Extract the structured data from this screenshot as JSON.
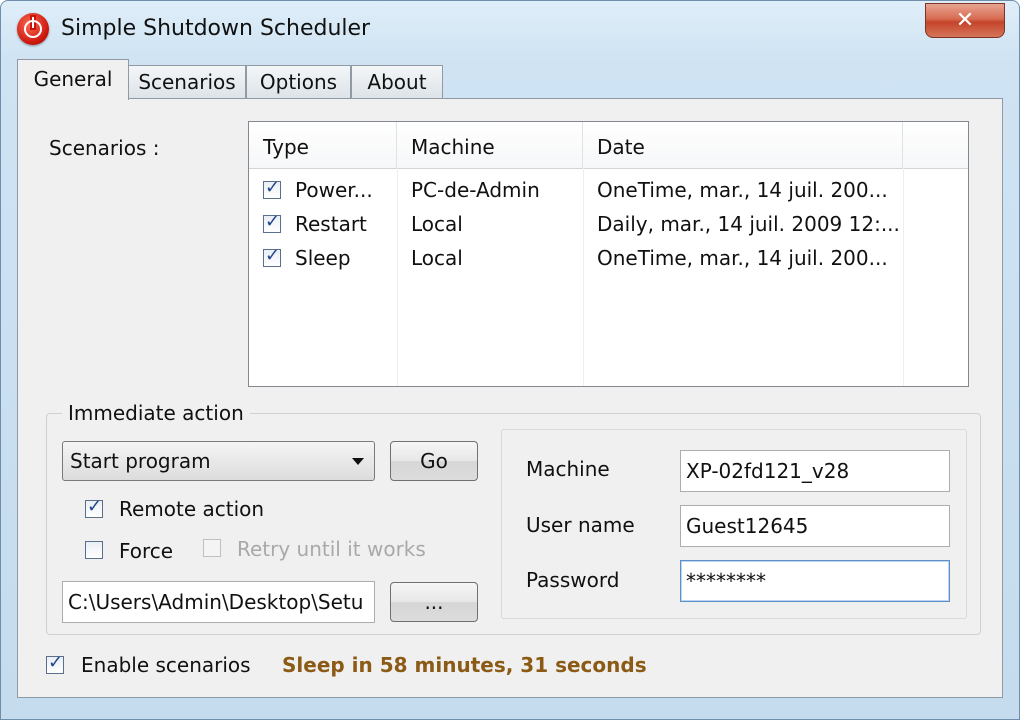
{
  "window": {
    "title": "Simple Shutdown Scheduler",
    "close_label": "✕"
  },
  "tabs": [
    {
      "label": "General",
      "active": true
    },
    {
      "label": "Scenarios",
      "active": false
    },
    {
      "label": "Options",
      "active": false
    },
    {
      "label": "About",
      "active": false
    }
  ],
  "scenarios": {
    "label": "Scenarios :",
    "columns": [
      "Type",
      "Machine",
      "Date"
    ],
    "rows": [
      {
        "checked": true,
        "type": "Power...",
        "machine": "PC-de-Admin",
        "date": "OneTime, mar., 14 juil. 200..."
      },
      {
        "checked": true,
        "type": "Restart",
        "machine": "Local",
        "date": "Daily, mar., 14 juil. 2009 12:..."
      },
      {
        "checked": true,
        "type": "Sleep",
        "machine": "Local",
        "date": "OneTime, mar., 14 juil. 200..."
      }
    ]
  },
  "immediate": {
    "title": "Immediate action",
    "action_selected": "Start program",
    "go_label": "Go",
    "remote_action_label": "Remote action",
    "remote_action_checked": true,
    "force_label": "Force",
    "force_checked": false,
    "retry_label": "Retry until it works",
    "retry_checked": false,
    "program_path": "C:\\Users\\Admin\\Desktop\\Setu",
    "browse_label": "..."
  },
  "remote": {
    "machine_label": "Machine",
    "machine_value": "XP-02fd121_v28",
    "username_label": "User name",
    "username_value": "Guest12645",
    "password_label": "Password",
    "password_value": "********"
  },
  "footer": {
    "enable_label": "Enable scenarios",
    "enable_checked": true,
    "status_text": "Sleep in 58 minutes, 31 seconds"
  },
  "colors": {
    "status": "#8b5a14",
    "selection_border": "#5d8fc9"
  }
}
